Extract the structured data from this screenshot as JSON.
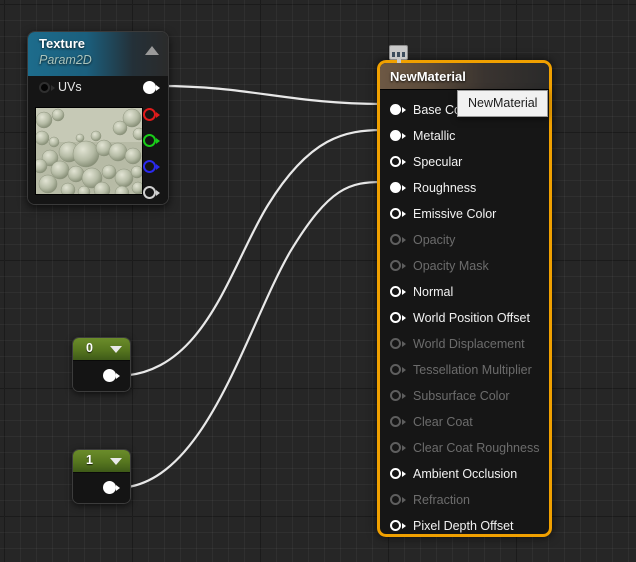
{
  "editor": {
    "name": "material-graph-editor",
    "background_color": "#262626",
    "grid_minor_color": "#2f2f2f",
    "grid_major_color": "#1a1a1a",
    "wire_color": "#e8e8e8"
  },
  "texture_node": {
    "title": "Texture",
    "subtitle": "Param2D",
    "header_color": "#1d6c8c",
    "collapse_icon": "triangle-up-icon",
    "input_pins": [
      {
        "label": "UVs",
        "connected": false,
        "color": "#0a0a0a"
      }
    ],
    "output_pins": [
      {
        "label": "",
        "channel": "RGB",
        "connected": true,
        "color": "#ffffff"
      },
      {
        "label": "",
        "channel": "R",
        "connected": false,
        "color": "#e01b1b"
      },
      {
        "label": "",
        "channel": "G",
        "connected": false,
        "color": "#19cc19"
      },
      {
        "label": "",
        "channel": "B",
        "connected": false,
        "color": "#2a2aee"
      },
      {
        "label": "",
        "channel": "A",
        "connected": false,
        "color": "#d0d0d0"
      }
    ],
    "preview_alt": "texture-thumbnail"
  },
  "constant_nodes": [
    {
      "value": "0",
      "header_color": "#56761f",
      "caret_icon": "triangle-down-icon",
      "connected": true
    },
    {
      "value": "1",
      "header_color": "#56761f",
      "caret_icon": "triangle-down-icon",
      "connected": true
    }
  ],
  "material_node": {
    "title": "NewMaterial",
    "selected": true,
    "selection_color": "#f0a000",
    "badge_icon": "material-apply-icon",
    "tooltip": "NewMaterial",
    "pins": [
      {
        "label": "Base Color",
        "enabled": true,
        "connected": true
      },
      {
        "label": "Metallic",
        "enabled": true,
        "connected": true
      },
      {
        "label": "Specular",
        "enabled": true,
        "connected": false
      },
      {
        "label": "Roughness",
        "enabled": true,
        "connected": true
      },
      {
        "label": "Emissive Color",
        "enabled": true,
        "connected": false
      },
      {
        "label": "Opacity",
        "enabled": false,
        "connected": false
      },
      {
        "label": "Opacity Mask",
        "enabled": false,
        "connected": false
      },
      {
        "label": "Normal",
        "enabled": true,
        "connected": false
      },
      {
        "label": "World Position Offset",
        "enabled": true,
        "connected": false
      },
      {
        "label": "World Displacement",
        "enabled": false,
        "connected": false
      },
      {
        "label": "Tessellation Multiplier",
        "enabled": false,
        "connected": false
      },
      {
        "label": "Subsurface Color",
        "enabled": false,
        "connected": false
      },
      {
        "label": "Clear Coat",
        "enabled": false,
        "connected": false
      },
      {
        "label": "Clear Coat Roughness",
        "enabled": false,
        "connected": false
      },
      {
        "label": "Ambient Occlusion",
        "enabled": true,
        "connected": false
      },
      {
        "label": "Refraction",
        "enabled": false,
        "connected": false
      },
      {
        "label": "Pixel Depth Offset",
        "enabled": true,
        "connected": false
      }
    ]
  },
  "connections": [
    {
      "from": "texture-output-rgb",
      "to": "material-pin-base-color"
    },
    {
      "from": "constant-0-output",
      "to": "material-pin-metallic"
    },
    {
      "from": "constant-1-output",
      "to": "material-pin-roughness"
    }
  ]
}
